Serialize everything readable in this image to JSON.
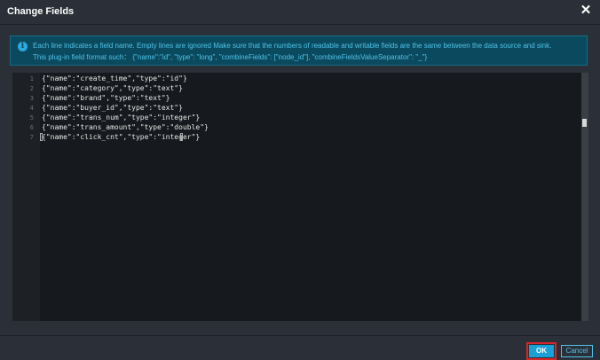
{
  "dialog": {
    "title": "Change Fields",
    "close_icon": "close-icon"
  },
  "info": {
    "icon": "info-icon",
    "icon_glyph": "i",
    "line1": "Each line indicates a field name. Empty lines are ignored Make sure that the numbers of readable and writable fields are the same between the data source and sink.",
    "line2": "This plug-in field format such： {\"name\":\"id\", \"type\": \"long\", \"combineFields\": [\"node_id\"], \"combineFieldsValueSeparator\": \"_\"}"
  },
  "editor": {
    "lines": [
      {
        "num": "1",
        "text": "{\"name\":\"create_time\",\"type\":\"id\"}"
      },
      {
        "num": "2",
        "text": "{\"name\":\"category\",\"type\":\"text\"}"
      },
      {
        "num": "3",
        "text": "{\"name\":\"brand\",\"type\":\"text\"}"
      },
      {
        "num": "4",
        "text": "{\"name\":\"buyer_id\",\"type\":\"text\"}"
      },
      {
        "num": "5",
        "text": "{\"name\":\"trans_num\",\"type\":\"integer\"}"
      },
      {
        "num": "6",
        "text": "{\"name\":\"trans_amount\",\"type\":\"double\"}"
      },
      {
        "num": "7",
        "text": "{\"name\":\"click_cnt\",\"type\":\"integer\"}"
      }
    ]
  },
  "footer": {
    "ok_label": "OK",
    "cancel_label": "Cancel"
  },
  "colors": {
    "accent": "#1aa0d3",
    "info_bg": "#0b4a5e",
    "info_text": "#4fc3ea",
    "highlight_border": "#d6262a"
  }
}
